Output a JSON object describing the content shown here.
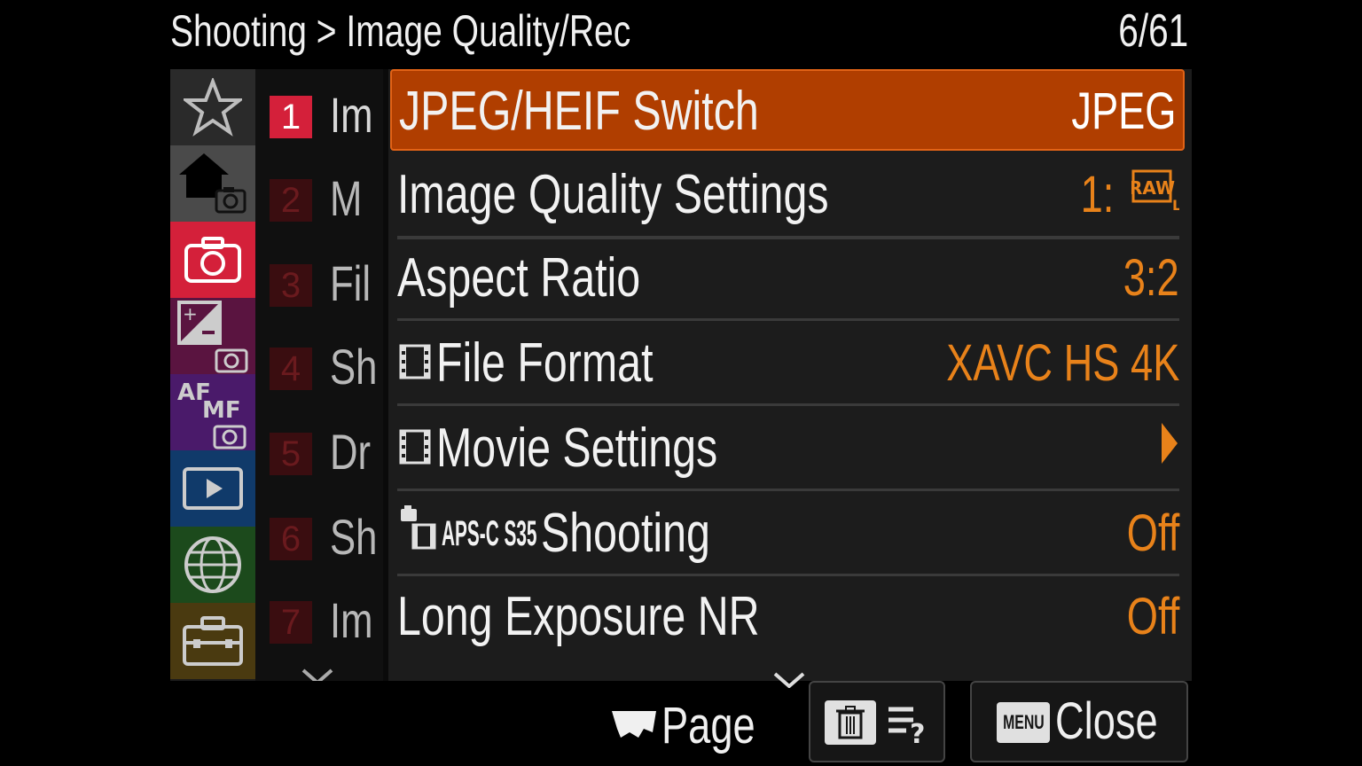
{
  "header": {
    "title": "Shooting > Image Quality/Rec",
    "page_counter": "6/61"
  },
  "categories": [
    {
      "icon": "star-icon"
    },
    {
      "icon": "home-camera-icon"
    },
    {
      "icon": "camera-icon"
    },
    {
      "icon": "exposure-camera-icon"
    },
    {
      "icon": "af-mf-camera-icon"
    },
    {
      "icon": "playback-icon"
    },
    {
      "icon": "globe-icon"
    },
    {
      "icon": "toolbox-icon"
    }
  ],
  "pages": [
    {
      "num": "1",
      "label": "Im",
      "selected": true
    },
    {
      "num": "2",
      "label": "M"
    },
    {
      "num": "3",
      "label": "Fil"
    },
    {
      "num": "4",
      "label": "Sh"
    },
    {
      "num": "5",
      "label": "Dr"
    },
    {
      "num": "6",
      "label": "Sh"
    },
    {
      "num": "7",
      "label": "Im"
    }
  ],
  "menu_items": [
    {
      "label": "JPEG/HEIF Switch",
      "value": "JPEG",
      "selected": true
    },
    {
      "label": "Image Quality Settings",
      "value": "1:",
      "value_icon": "raw-l-icon"
    },
    {
      "label": "Aspect Ratio",
      "value": "3:2"
    },
    {
      "label": "File Format",
      "value": "XAVC HS 4K",
      "label_icon": "movie-icon"
    },
    {
      "label": "Movie Settings",
      "value_icon": "arrow-right-icon",
      "label_icon": "movie-icon"
    },
    {
      "label": "Shooting",
      "prefix": "APS-C S35",
      "value": "Off",
      "label_icon": "still-movie-icon"
    },
    {
      "label": "Long Exposure NR",
      "value": "Off"
    }
  ],
  "raw_badge": "RAW",
  "raw_badge_sub": "L",
  "footer": {
    "page_label": "Page",
    "menu_badge": "MENU",
    "close_label": "Close"
  },
  "colors": {
    "selected_row": "#b03e00",
    "value_text": "#e8821a",
    "camera_category": "#d4203a"
  }
}
